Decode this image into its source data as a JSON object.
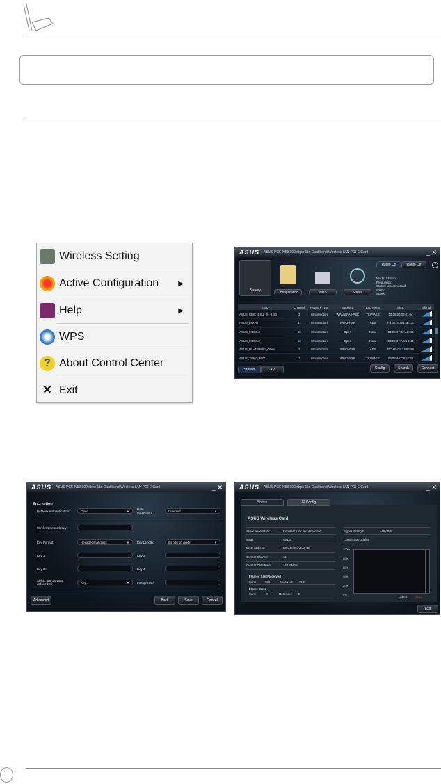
{
  "menu": {
    "items": [
      {
        "label": "Wireless Setting",
        "icon": "wireless-setting-icon",
        "submenu": false
      },
      {
        "label": "Active Configuration",
        "icon": "active-configuration-icon",
        "submenu": true
      },
      {
        "label": "Help",
        "icon": "help-book-icon",
        "submenu": true
      },
      {
        "label": "WPS",
        "icon": "wps-icon",
        "submenu": false
      },
      {
        "label": "About Control Center",
        "icon": "about-question-icon",
        "submenu": false
      },
      {
        "label": "Exit",
        "icon": "exit-x-icon",
        "submenu": false
      }
    ]
  },
  "survey_window": {
    "logo": "ASUS",
    "title": "ASUS PCE-N53 300Mbps 11n Dual band Wireless LAN PCI-E Card",
    "nav": [
      "Survey",
      "Configuration",
      "WPS",
      "Status"
    ],
    "radio_on": "Radio On",
    "radio_off": "Radio Off",
    "help": "?",
    "status_lines": [
      "Mode: Station",
      "Frequency:",
      "Status: Unconnected",
      "SSID:",
      "Speed:"
    ],
    "columns": [
      "SSID",
      "Channel",
      "Network Type",
      "Security",
      "Encryption",
      "MAC",
      "Signal"
    ],
    "rows": [
      [
        "ASUS_EBIC_BSU_#5_2.4G",
        "2",
        "Infrastructure",
        "WPA/WPA2-PSK",
        "TKIP/AES",
        "00:25:00:00:01:04"
      ],
      [
        "ASUS_EGON",
        "11",
        "Infrastructure",
        "WPA2-PSK",
        "AES",
        "F4:60:04:DB:4E:CE"
      ],
      [
        "ASUS_MOBILE",
        "10",
        "Infrastructure",
        "Open",
        "None",
        "00:0E:07:82:AE:C0"
      ],
      [
        "ASUS_MOBILE",
        "10",
        "Infrastructure",
        "Open",
        "None",
        "00:0E:07:AC:1C:40"
      ],
      [
        "ASUS_WL-330N3G_Office",
        "2",
        "Infrastructure",
        "WPA2-PSK",
        "AES",
        "BC:AE:C5:73:8F:68"
      ],
      [
        "ASUS_XORD_PRT",
        "1",
        "Infrastructure",
        "WPA2-PSK",
        "TKIP/AES",
        "54:04:A6:C8:F5:34"
      ]
    ],
    "mode_tabs": [
      "Station",
      "AP"
    ],
    "buttons": [
      "Config",
      "Search",
      "Connect"
    ]
  },
  "encryption_window": {
    "logo": "ASUS",
    "title": "ASUS PCE-N53 300Mbps 11n Dual band Wireless LAN PCI-E Card",
    "heading": "Encryption",
    "network_auth_label": "Network Authentication:",
    "network_auth": "Open",
    "data_enc_label": "Data encryption:",
    "data_enc": "Disabled",
    "wireless_key_label": "Wireless network key:",
    "key_format_label": "Key Format:",
    "key_format": "Hexadecimal digits",
    "key_length_label": "Key Length:",
    "key_length": "64 bits(10 digits)",
    "key1": "Key 1:",
    "key2": "Key 2:",
    "key3": "Key 3:",
    "key4": "Key 4:",
    "default_key_label": "Select one as your default key:",
    "default_key": "Key 1",
    "passphrase_label": "Passphrase:",
    "advanced": "Advanced",
    "back": "Back",
    "save": "Save",
    "cancel": "Cancel"
  },
  "status_window": {
    "logo": "ASUS",
    "title": "ASUS PCE-N53 300Mbps 11n Dual band Wireless LAN PCI-E Card",
    "tabs": [
      "Status",
      "IP Config"
    ],
    "heading": "ASUS Wireless Card",
    "fields": [
      [
        "Association State:",
        "Excellent Link and Associate"
      ],
      [
        "SSID:",
        "ASUS"
      ],
      [
        "MAC address:",
        "BC:AE:C5:A4:AF:4B"
      ],
      [
        "Current Channel:",
        "11"
      ],
      [
        "Current Data Rate:",
        "144.4 Mbps"
      ]
    ],
    "frames_label": "Frames Sent/Received",
    "sent_label": "Sent:",
    "sent": "970",
    "received_label": "Received:",
    "received": "7980",
    "error_label": "Frame Error",
    "err_sent": "0",
    "err_received": "0",
    "signal_label": "Signal Strength:",
    "signal": "-46 dBm",
    "quality_label": "Connection Quality:",
    "chart_ticks": [
      "100%",
      "80%",
      "60%",
      "40%",
      "20%",
      "0%"
    ],
    "legend": [
      "ANT1",
      "ANT2"
    ],
    "exit": "Exit"
  }
}
